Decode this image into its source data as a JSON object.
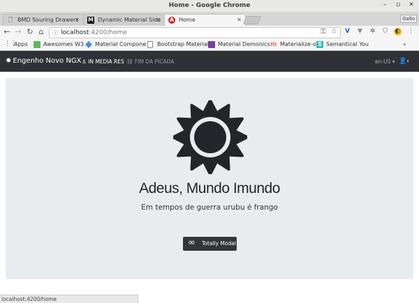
{
  "window": {
    "title": "Home - Google Chrome",
    "user_button": "Gallo"
  },
  "tabs": [
    {
      "label": "BMD Souring Drawers",
      "icon": "document-icon"
    },
    {
      "label": "Dynamic Material Side",
      "icon": "medium-icon"
    },
    {
      "label": "Home",
      "icon": "angular-icon",
      "active": true
    }
  ],
  "address": {
    "host": "localhost",
    "path": ":4200/home"
  },
  "bookmarks": [
    {
      "label": "Apps",
      "icon": "apps-grid-icon",
      "color": "#555555"
    },
    {
      "label": "Awesomes W3",
      "icon": "w3-icon",
      "color": "#5fb85c"
    },
    {
      "label": "Material Compone",
      "icon": "material-icon",
      "color": "#3f8fd8"
    },
    {
      "label": "Bootstrap Material",
      "icon": "document-icon",
      "color": "#ffffff"
    },
    {
      "label": "Material Demonics",
      "icon": "demonics-icon",
      "color": "#7b3fa0"
    },
    {
      "label": "Materialize-o",
      "icon": "materialize-icon",
      "color": "#ee6e73"
    },
    {
      "label": "Semantical You",
      "icon": "semantic-icon",
      "color": "#35bdb2"
    }
  ],
  "app": {
    "brand": "Engenho Novo NGX",
    "nav": [
      {
        "label": "IN MEDIA RES",
        "icon": "anchor-icon",
        "active": true
      },
      {
        "label": "FIM DA PICADA",
        "icon": "sitemap-icon",
        "active": false
      }
    ],
    "locale": "en-US",
    "colors": {
      "navbar": "#303136",
      "hero": "#e9ecef",
      "button": "#33353a"
    }
  },
  "hero": {
    "title": "Adeus, Mundo Imundo",
    "subtitle": "Em tempos de guerra urubu é frango",
    "button_label": "Totally Modal"
  },
  "status": {
    "url": "localhost:4200/home"
  }
}
